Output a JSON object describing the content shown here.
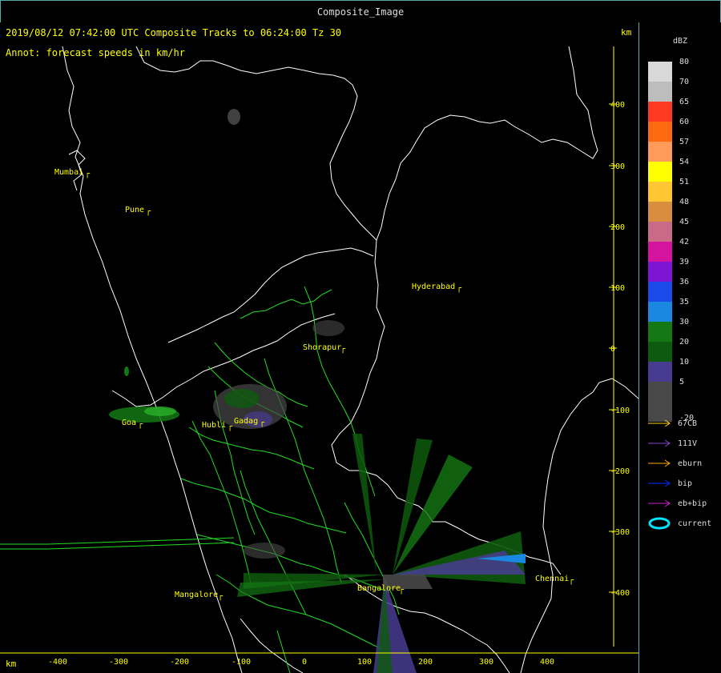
{
  "window": {
    "title": "Composite_Image"
  },
  "header": {
    "line1": "2019/08/12 07:42:00 UTC Composite Tracks to 06:24:00 Tz 30",
    "line2": "Annot: forecast speeds in km/hr",
    "km_unit_top": "km",
    "km_unit_bottom": "km"
  },
  "axes": {
    "x_ticks": [
      "-400",
      "-300",
      "-200",
      "-100",
      "0",
      "100",
      "200",
      "300",
      "400"
    ],
    "y_ticks": [
      "400",
      "300",
      "200",
      "100",
      "0",
      "-100",
      "-200",
      "-300",
      "-400"
    ]
  },
  "cities": [
    {
      "name": "Mumbai",
      "key": "mumbai"
    },
    {
      "name": "Pune",
      "key": "pune"
    },
    {
      "name": "Hyderabad",
      "key": "hyderabad"
    },
    {
      "name": "Shorapur",
      "key": "shorapur"
    },
    {
      "name": "Gadag",
      "key": "gadag"
    },
    {
      "name": "Hubli",
      "key": "hubli"
    },
    {
      "name": "Goa",
      "key": "goa"
    },
    {
      "name": "Mangalore",
      "key": "mangalore"
    },
    {
      "name": "Bangalore",
      "key": "bangalore"
    },
    {
      "name": "Chennai",
      "key": "chennai"
    }
  ],
  "legend": {
    "title": "dBZ",
    "scale": [
      {
        "value": "80",
        "color": "#d8d8d8"
      },
      {
        "value": "70",
        "color": "#bdbdbd"
      },
      {
        "value": "65",
        "color": "#ff3a22"
      },
      {
        "value": "60",
        "color": "#ff6a10"
      },
      {
        "value": "57",
        "color": "#ff9a5a"
      },
      {
        "value": "54",
        "color": "#ffff00"
      },
      {
        "value": "51",
        "color": "#ffc633"
      },
      {
        "value": "48",
        "color": "#d88e3e"
      },
      {
        "value": "45",
        "color": "#c86a88"
      },
      {
        "value": "42",
        "color": "#d414a0"
      },
      {
        "value": "39",
        "color": "#8014d4"
      },
      {
        "value": "36",
        "color": "#1a4ae8"
      },
      {
        "value": "35",
        "color": "#1a88e0"
      },
      {
        "value": "30",
        "color": "#147814"
      },
      {
        "value": "20",
        "color": "#0e5a0e"
      },
      {
        "value": "10",
        "color": "#483c90"
      },
      {
        "value": "5",
        "color": "#484848"
      },
      {
        "value": "-20",
        "color": "#484848"
      }
    ],
    "tracks": [
      {
        "label": "67CB",
        "color": "#ffd21e",
        "kind": "arrow"
      },
      {
        "label": "111V",
        "color": "#8844cc",
        "kind": "arrow"
      },
      {
        "label": "eburn",
        "color": "#ffaa00",
        "kind": "arrow"
      },
      {
        "label": "bip",
        "color": "#0030ff",
        "kind": "arrow"
      },
      {
        "label": "eb+bip",
        "color": "#cc22cc",
        "kind": "arrow"
      },
      {
        "label": "current",
        "color": "#00e5ff",
        "kind": "ellipse"
      }
    ]
  }
}
